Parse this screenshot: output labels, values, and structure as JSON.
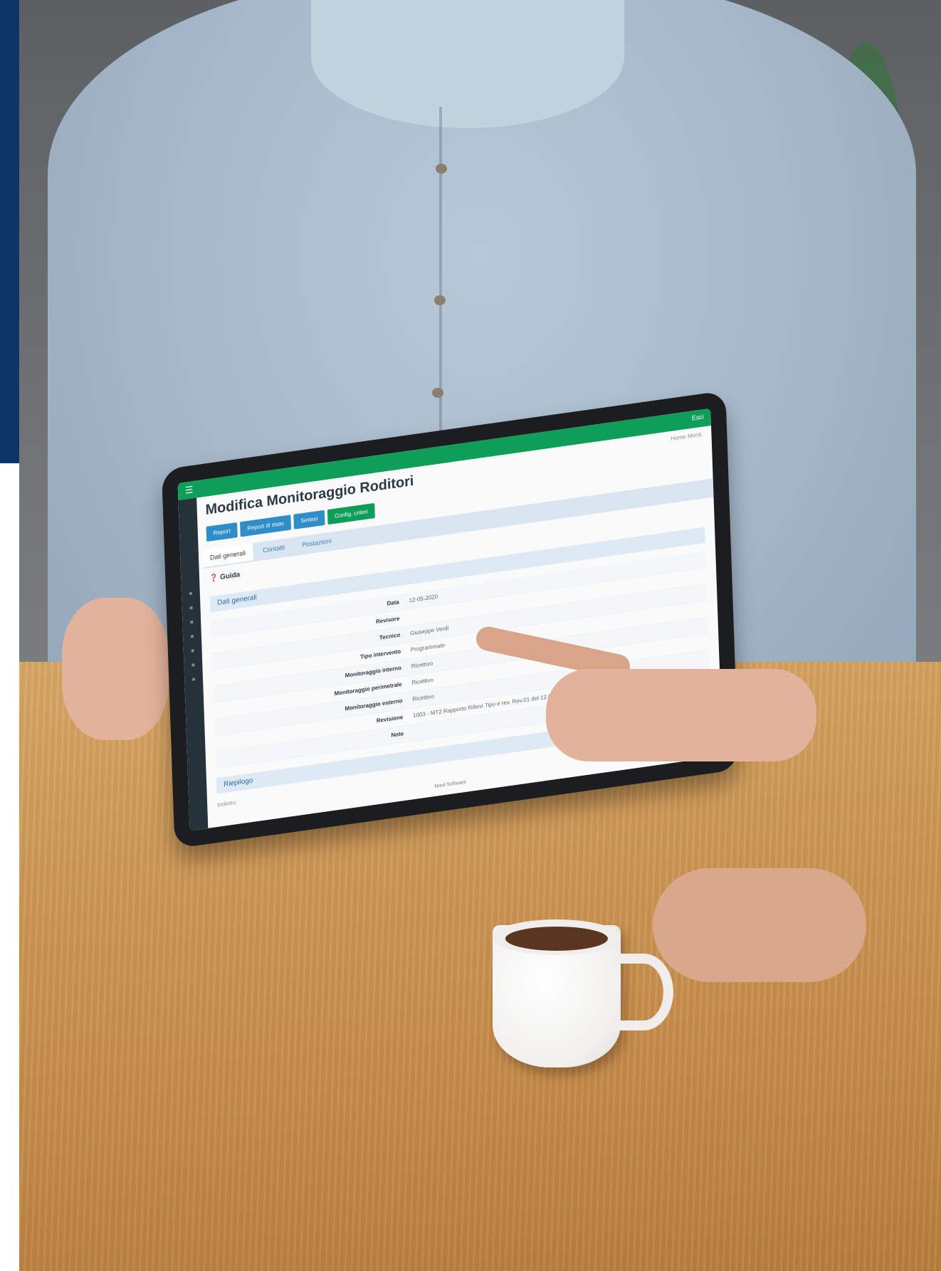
{
  "tablet_app": {
    "menu_icon": "hamburger-icon",
    "user_label": "Esci",
    "breadcrumbs": "Home  Monit.",
    "title": "Modifica Monitoraggio Roditori",
    "buttons": [
      "Report",
      "Report di stato",
      "Sintesi",
      "Config. criteri"
    ],
    "tabs": [
      "Dati generali",
      "Contatti",
      "Postazioni"
    ],
    "help_label": "Guida",
    "section_general": "Dati generali",
    "fields": [
      {
        "label": "Data",
        "value": "12-05-2020"
      },
      {
        "label": "Revisore",
        "value": ""
      },
      {
        "label": "Tecnico",
        "value": "Giuseppe Verdi"
      },
      {
        "label": "Tipo intervento",
        "value": "Programmato"
      },
      {
        "label": "Monitoraggio interno",
        "value": "Ricettivo"
      },
      {
        "label": "Monitoraggio perimetrale",
        "value": "Ricettivo"
      },
      {
        "label": "Monitoraggio esterno",
        "value": "Ricettivo"
      },
      {
        "label": "Revisione",
        "value": "1003 - MT2 Rapporto Rilievi Tipo e rev. Rev.01 del 12.05.2020"
      },
      {
        "label": "Note",
        "value": ""
      }
    ],
    "section_second": "Riepilogo",
    "footer_center": "Nord Software",
    "footer_left": "Indietro"
  }
}
